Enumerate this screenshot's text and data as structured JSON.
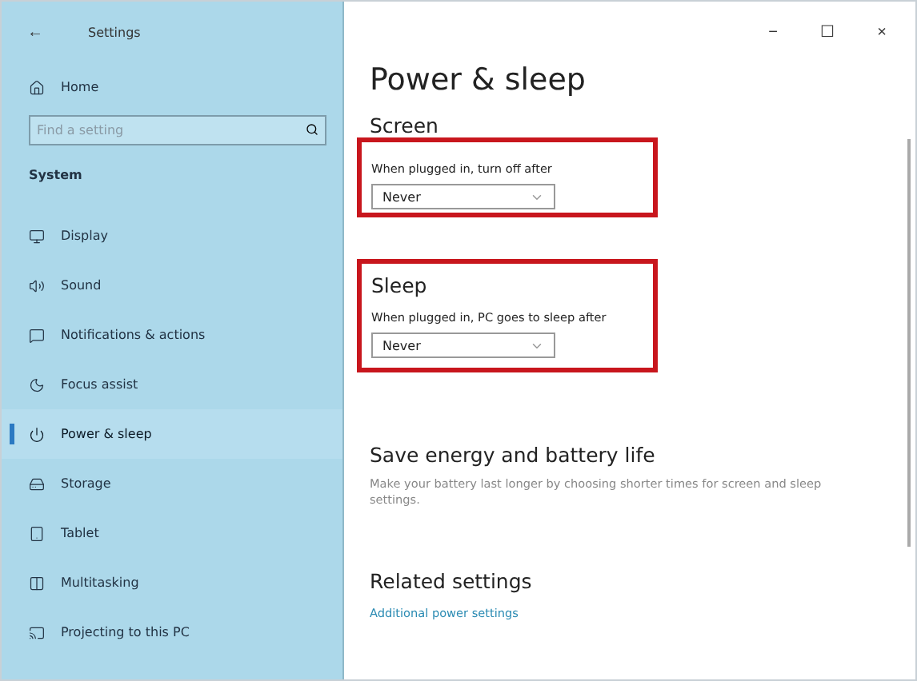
{
  "window": {
    "title": "Settings",
    "back": "←",
    "controls": [
      "−",
      "☐",
      "×"
    ]
  },
  "sidebar": {
    "home": "Home",
    "search": {
      "placeholder": "Find a setting"
    },
    "section": "System",
    "items": [
      {
        "label": "Display",
        "selected": false
      },
      {
        "label": "Sound",
        "selected": false
      },
      {
        "label": "Notifications & actions",
        "selected": false
      },
      {
        "label": "Focus assist",
        "selected": false
      },
      {
        "label": "Power & sleep",
        "selected": true
      },
      {
        "label": "Storage",
        "selected": false
      },
      {
        "label": "Tablet",
        "selected": false
      },
      {
        "label": "Multitasking",
        "selected": false
      },
      {
        "label": "Projecting to this PC",
        "selected": false
      }
    ]
  },
  "page": {
    "title": "Power & sleep",
    "groups": [
      {
        "heading": "Screen",
        "label": "When plugged in, turn off after",
        "value": "Never",
        "highlighted": true
      },
      {
        "heading": "Sleep",
        "label": "When plugged in, PC goes to sleep after",
        "value": "Never",
        "highlighted": true
      }
    ],
    "energy": {
      "heading": "Save energy and battery life",
      "text": "Make your battery last longer by choosing shorter times for screen and sleep settings."
    },
    "related": {
      "heading": "Related settings",
      "link": "Additional power settings"
    }
  }
}
